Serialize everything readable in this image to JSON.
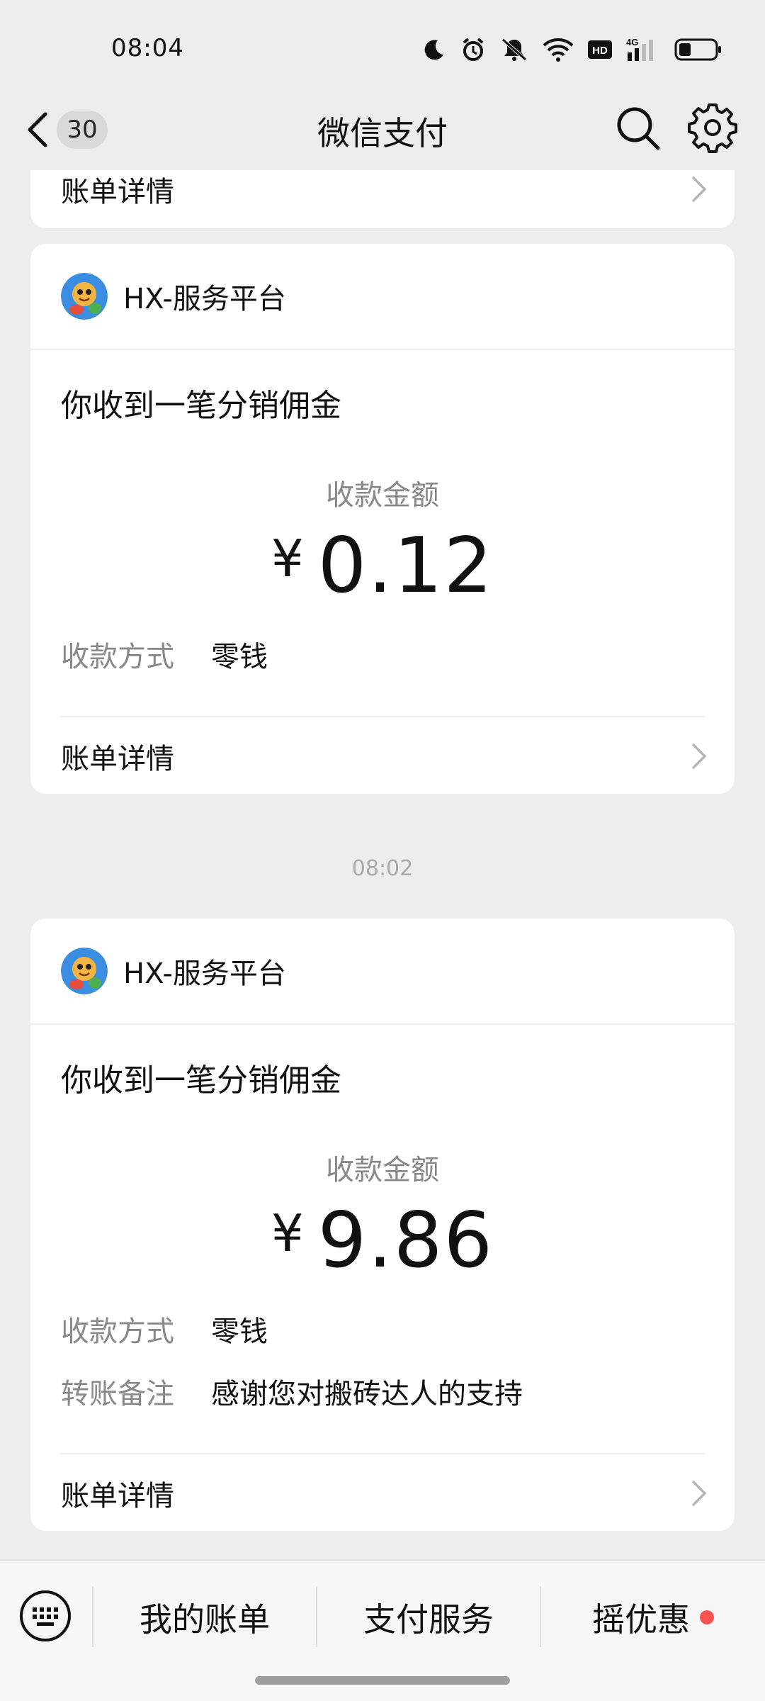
{
  "status_bar": {
    "time": "08:04",
    "icons": [
      "moon-icon",
      "alarm-icon",
      "mute-icon",
      "wifi-icon",
      "hd-icon",
      "signal-4g-icon",
      "battery-icon"
    ],
    "hd_text": "HD",
    "network_text": "4G"
  },
  "nav": {
    "back_count": "30",
    "title": "微信支付"
  },
  "partial_card": {
    "detail_label": "账单详情"
  },
  "messages": [
    {
      "sender": "HX-服务平台",
      "title": "你收到一笔分销佣金",
      "amount_label": "收款金额",
      "currency": "¥",
      "amount": "0.12",
      "fields": [
        {
          "key": "收款方式",
          "value": "零钱"
        }
      ],
      "detail_label": "账单详情"
    },
    {
      "timestamp": "08:02",
      "sender": "HX-服务平台",
      "title": "你收到一笔分销佣金",
      "amount_label": "收款金额",
      "currency": "¥",
      "amount": "9.86",
      "fields": [
        {
          "key": "收款方式",
          "value": "零钱"
        },
        {
          "key": "转账备注",
          "value": "感谢您对搬砖达人的支持"
        }
      ],
      "detail_label": "账单详情"
    }
  ],
  "bottom_bar": {
    "tabs": [
      "我的账单",
      "支付服务",
      "摇优惠"
    ],
    "badge_color": "#fa5151"
  }
}
